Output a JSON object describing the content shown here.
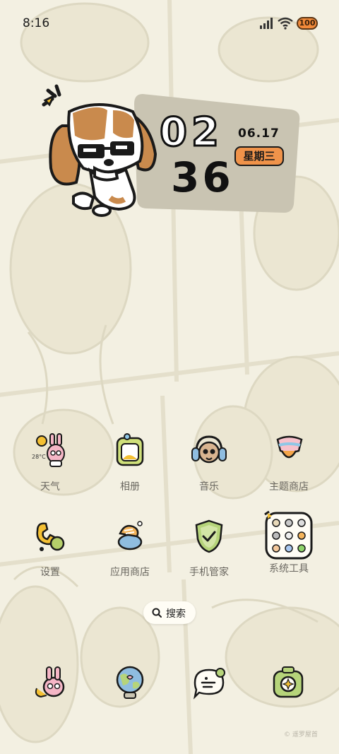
{
  "status_bar": {
    "time": "8:16",
    "battery_level": "100",
    "icons": [
      "signal-icon",
      "wifi-icon",
      "battery-icon"
    ]
  },
  "clock_widget": {
    "hours": "02",
    "minutes": "36",
    "date": "06.17",
    "weekday": "星期三",
    "accent_color": "#f0934a"
  },
  "apps": [
    {
      "label": "天气",
      "icon": "weather-icon",
      "temp": "28°C"
    },
    {
      "label": "相册",
      "icon": "gallery-icon"
    },
    {
      "label": "音乐",
      "icon": "music-icon"
    },
    {
      "label": "主题商店",
      "icon": "theme-store-icon"
    },
    {
      "label": "设置",
      "icon": "settings-icon"
    },
    {
      "label": "应用商店",
      "icon": "app-store-icon"
    },
    {
      "label": "手机管家",
      "icon": "phone-manager-icon"
    },
    {
      "label": "系统工具",
      "icon": "system-tools-icon"
    }
  ],
  "search": {
    "label": "搜索"
  },
  "dock": [
    {
      "icon": "phone-icon"
    },
    {
      "icon": "browser-icon"
    },
    {
      "icon": "messages-icon"
    },
    {
      "icon": "camera-icon"
    }
  ],
  "watermark": "© 遥罗屋首"
}
